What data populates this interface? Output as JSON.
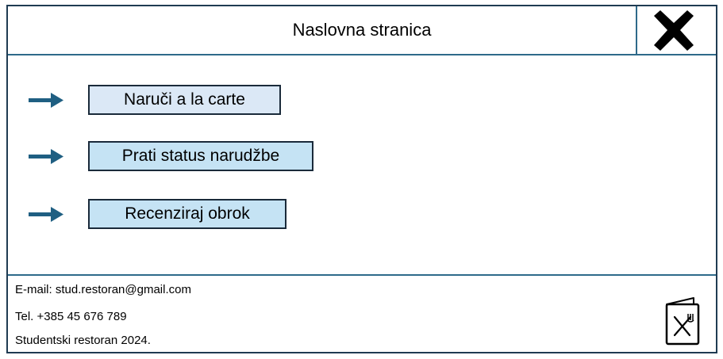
{
  "header": {
    "title": "Naslovna stranica",
    "close_icon": "close-x-icon"
  },
  "menu": {
    "items": [
      {
        "label": "Naruči a la carte",
        "color": "#dbe8f6",
        "icon": "arrow-right-icon"
      },
      {
        "label": "Prati status narudžbe",
        "color": "#c5e3f4",
        "icon": "arrow-right-icon"
      },
      {
        "label": "Recenziraj obrok",
        "color": "#c5e3f4",
        "icon": "arrow-right-icon"
      }
    ],
    "arrow_color": "#1f5f82"
  },
  "footer": {
    "email": "E-mail: stud.restoran@gmail.com",
    "phone": "Tel. +385 45 676 789",
    "copyright": "Studentski restoran 2024.",
    "icon": "restaurant-menu-icon"
  },
  "colors": {
    "border": "#1f3b52",
    "divider": "#2e6a8a"
  }
}
